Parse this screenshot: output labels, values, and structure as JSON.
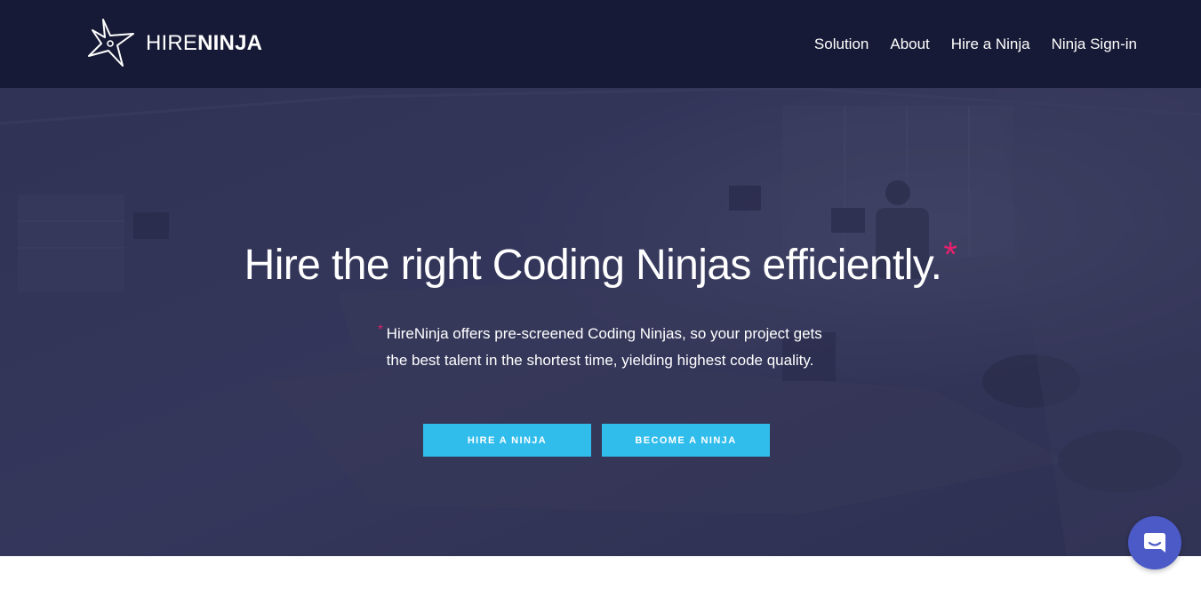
{
  "brand": {
    "name_light": "HIRE",
    "name_bold": "NINJA",
    "logo_icon": "shuriken-icon"
  },
  "nav": {
    "items": [
      {
        "label": "Solution"
      },
      {
        "label": "About"
      },
      {
        "label": "Hire a Ninja"
      },
      {
        "label": "Ninja Sign-in"
      }
    ]
  },
  "hero": {
    "title": "Hire the right Coding Ninjas efficiently.",
    "title_mark": "*",
    "subtitle_mark": "*",
    "subtitle": "HireNinja offers pre-screened Coding Ninjas, so your project gets the best talent in the shortest time, yielding highest code quality.",
    "buttons": {
      "hire": "HIRE A NINJA",
      "become": "BECOME A NINJA"
    }
  },
  "chat": {
    "icon": "chat-bubble-icon"
  },
  "colors": {
    "navbar": "#171a36",
    "accent": "#31bdec",
    "asterisk": "#e8216c",
    "chat": "#4b5ac6"
  }
}
